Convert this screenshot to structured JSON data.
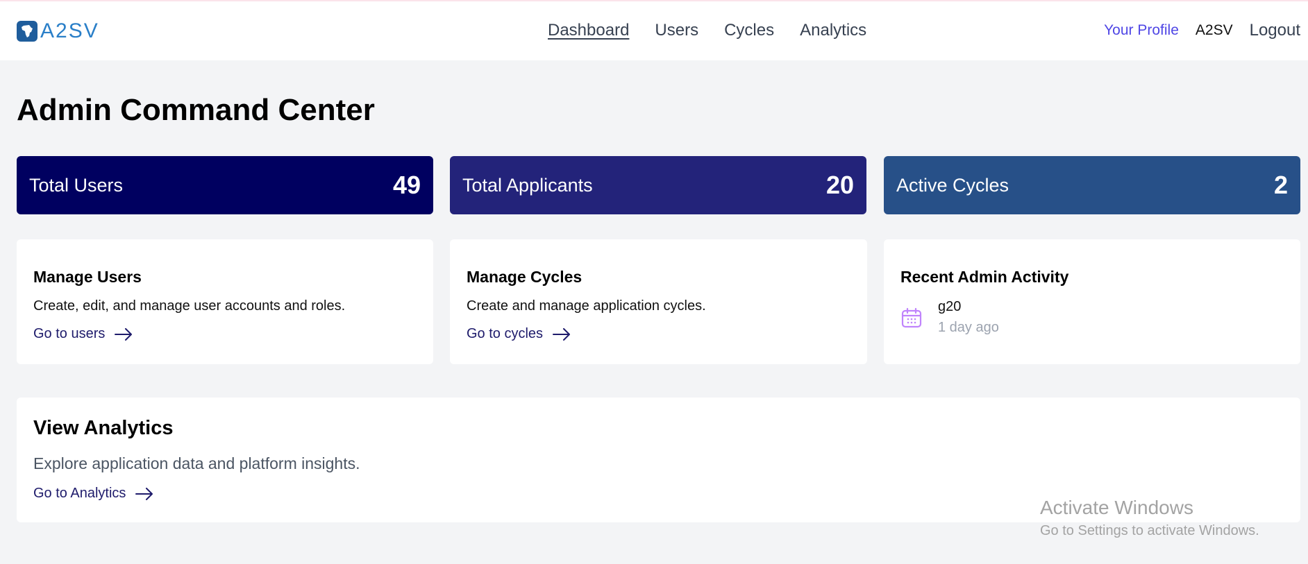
{
  "header": {
    "logo_text": "A2SV",
    "nav": [
      "Dashboard",
      "Users",
      "Cycles",
      "Analytics"
    ],
    "active_nav": "Dashboard",
    "profile": "Your Profile",
    "org": "A2SV",
    "logout": "Logout"
  },
  "page_title": "Admin Command Center",
  "stats": [
    {
      "label": "Total Users",
      "value": "49",
      "color": "#000060"
    },
    {
      "label": "Total Applicants",
      "value": "20",
      "color": "#23237a"
    },
    {
      "label": "Active Cycles",
      "value": "2",
      "color": "#275088"
    }
  ],
  "cards": {
    "users": {
      "title": "Manage Users",
      "desc": "Create, edit, and manage user accounts and roles.",
      "link": "Go to users"
    },
    "cycles": {
      "title": "Manage Cycles",
      "desc": "Create and manage application cycles.",
      "link": "Go to cycles"
    },
    "activity": {
      "title": "Recent Admin Activity",
      "item_title": "g20",
      "item_time": "1 day ago",
      "icon": "calendar-icon"
    }
  },
  "analytics": {
    "title": "View Analytics",
    "desc": "Explore application data and platform insights.",
    "link": "Go to Analytics"
  },
  "watermark": {
    "line1": "Activate Windows",
    "line2": "Go to Settings to activate Windows."
  }
}
